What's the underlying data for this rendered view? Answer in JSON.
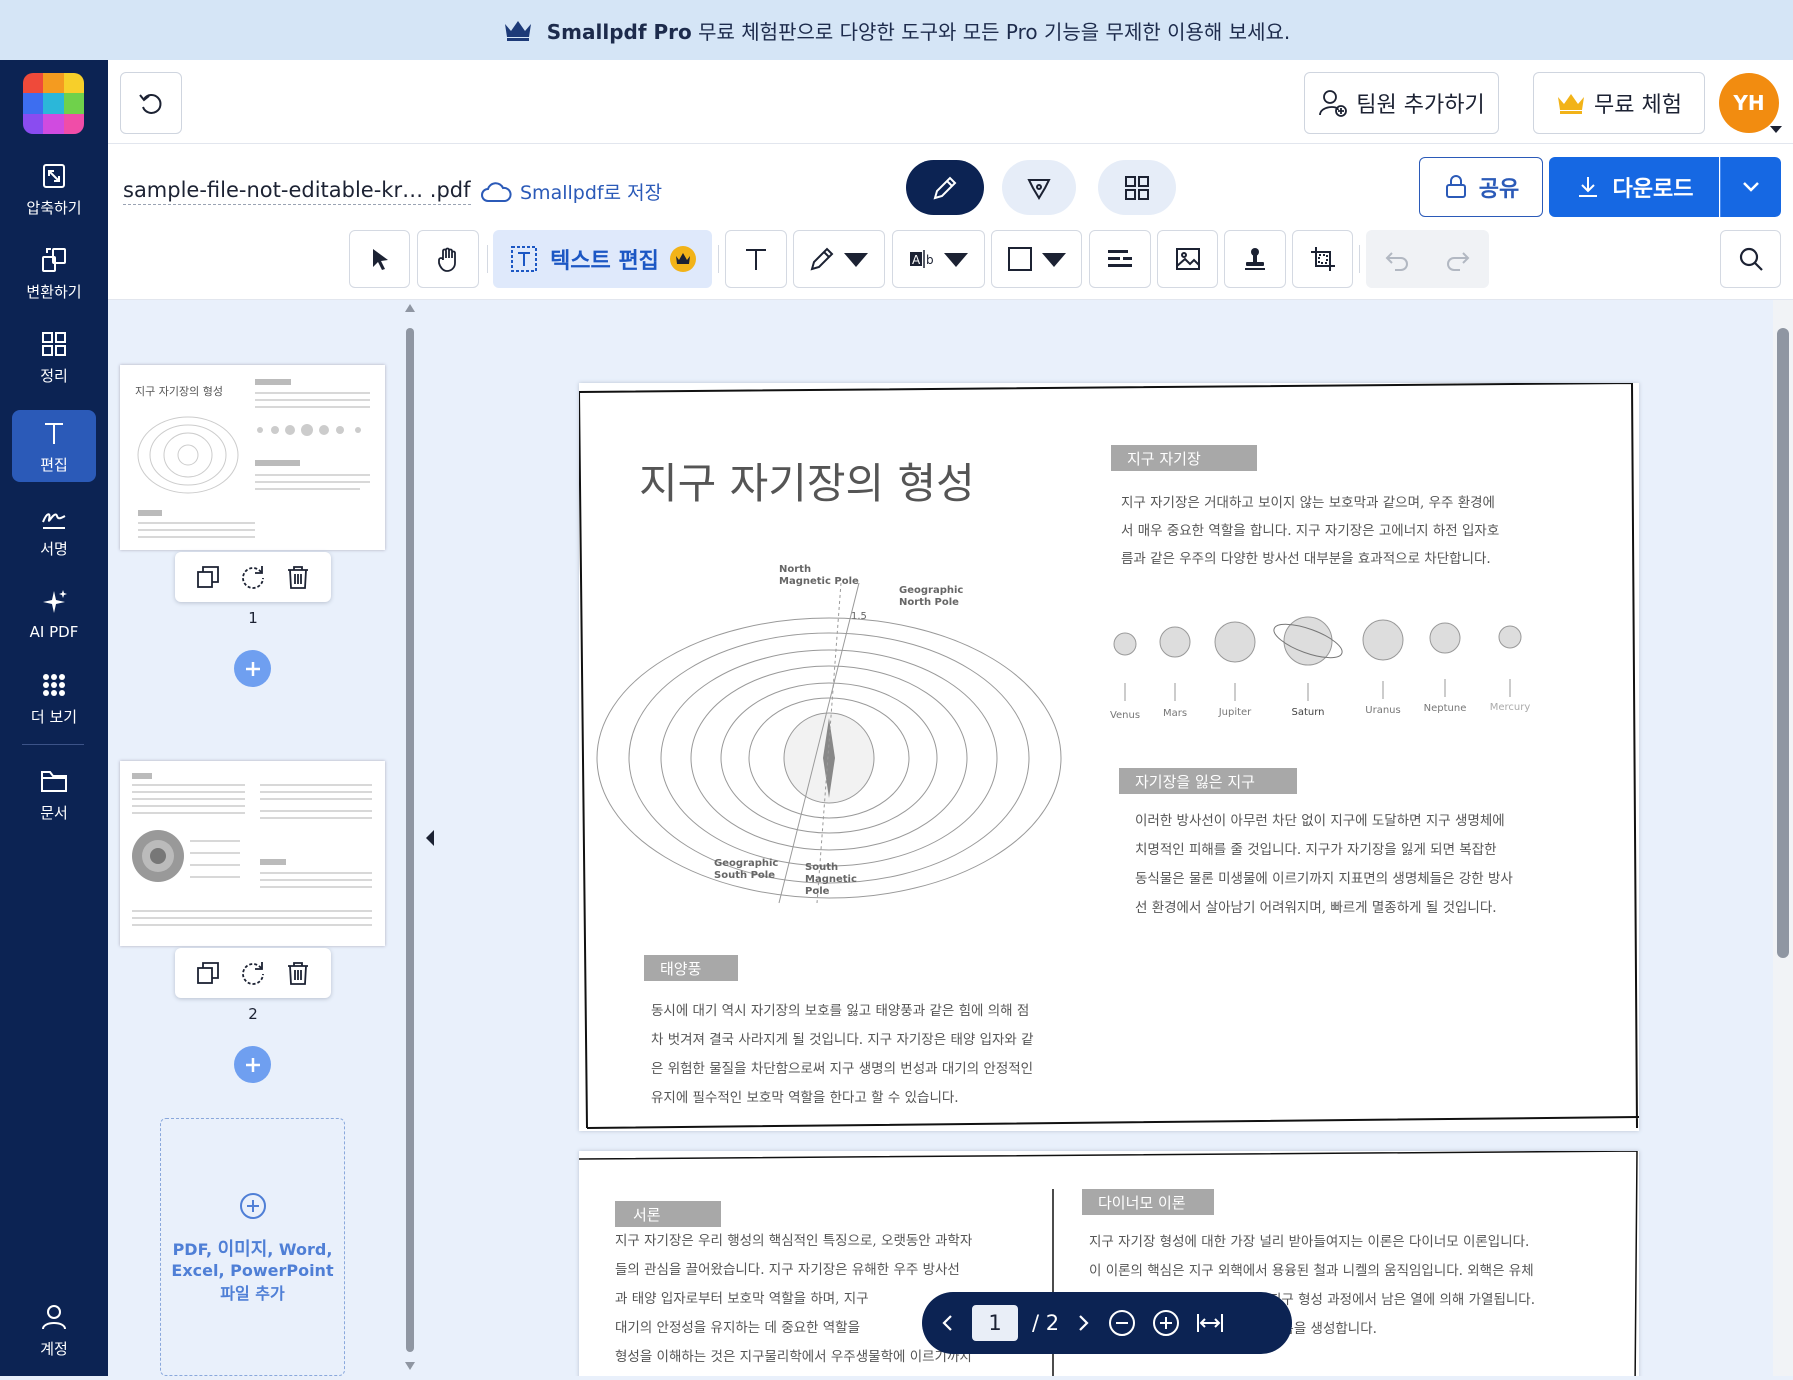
{
  "banner": {
    "brand": "Smallpdf Pro",
    "message": " 무료 체험판으로 다양한 도구와 모든 Pro 기능을 무제한 이용해 보세요."
  },
  "sidebar": {
    "items": [
      {
        "label": "압축하기",
        "icon": "compress-icon"
      },
      {
        "label": "변환하기",
        "icon": "convert-icon"
      },
      {
        "label": "정리",
        "icon": "organize-icon"
      },
      {
        "label": "편집",
        "icon": "edit-text-icon"
      },
      {
        "label": "서명",
        "icon": "signature-icon"
      },
      {
        "label": "AI PDF",
        "icon": "ai-sparkle-icon"
      },
      {
        "label": "더 보기",
        "icon": "more-grid-icon"
      },
      {
        "label": "문서",
        "icon": "folder-icon"
      },
      {
        "label": "계정",
        "icon": "account-icon"
      }
    ],
    "active": "편집"
  },
  "topbar": {
    "add_member": "팀원 추가하기",
    "free_trial": "무료 체험",
    "avatar": "YH"
  },
  "document": {
    "filename": "sample-file-not-editable-kr… .pdf",
    "save_to": "Smallpdf로 저장"
  },
  "actions": {
    "share": "공유",
    "download": "다운로드"
  },
  "toolbar": {
    "text_edit": "텍스트 편집"
  },
  "thumbnails": {
    "pages": [
      "1",
      "2"
    ],
    "dropzone": [
      "PDF, ",
      "이미지",
      ", Word, Excel, PowerPoint 파일 추가"
    ]
  },
  "pager": {
    "current": "1",
    "total": "/ 2"
  },
  "page1": {
    "title": "지구 자기장의 형성",
    "sec1_title": "지구 자기장",
    "sec1_lines": [
      "지구 자기장은 거대하고 보이지 않는 보호막과 같으며, 우주 환경에",
      "서 매우 중요한 역할을 합니다. 지구 자기장은 고에너지 하전 입자호",
      "름과 같은 우주의 다양한 방사선 대부분을 효과적으로 차단합니다."
    ],
    "planets": [
      "Venus",
      "Mars",
      "Jupiter",
      "Saturn",
      "Uranus",
      "Neptune",
      "Mercury"
    ],
    "diagram_labels": {
      "north_mag": [
        "North",
        "Magnetic Pole"
      ],
      "geo_north": [
        "Geographic",
        "North Pole"
      ],
      "geo_south": [
        "Geographic",
        "South Pole"
      ],
      "south_mag": [
        "South",
        "Magnetic",
        "Pole"
      ],
      "angle": "1.5"
    },
    "sec2_title": "자기장을 잃은 지구",
    "sec2_lines": [
      "이러한 방사선이 아무런 차단 없이 지구에 도달하면 지구 생명체에",
      "치명적인 피해를 줄 것입니다. 지구가 자기장을 잃게 되면 복잡한",
      "동식물은 물론 미생물에 이르기까지 지표면의 생명체들은 강한 방사",
      "선 환경에서 살아남기 어려워지며, 빠르게 멸종하게 될 것입니다."
    ],
    "sec3_title": "태양풍",
    "sec3_lines": [
      "동시에 대기 역시 자기장의 보호를 잃고 태양풍과 같은 힘에 의해 점",
      "차 벗겨져 결국 사라지게 될 것입니다. 지구 자기장은 태양 입자와 같",
      "은 위험한 물질을 차단함으로써 지구 생명의 번성과 대기의 안정적인",
      "유지에 필수적인 보호막 역할을 한다고 할 수 있습니다."
    ]
  },
  "page2": {
    "left_title": "서론",
    "left_lines": [
      "지구 자기장은 우리 행성의 핵심적인 특징으로, 오랫동안 과학자",
      "들의 관심을 끌어왔습니다. 지구 자기장은 유해한 우주 방사선",
      "과 태양 입자로부터 보호막 역할을 하며, 지구",
      "대기의 안정성을 유지하는 데 중요한 역할을",
      "형성을 이해하는 것은 지구물리학에서 우주생물학에 이르기까지"
    ],
    "right_title": "다이너모 이론",
    "right_lines": [
      "지구 자기장 형성에 대한 가장 널리 받아들여지는 이론은 다이너모 이론입니다.",
      "이 이론의 핵심은 지구 외핵에서 용융된 철과 니켈의 움직임입니다. 외핵은 유체",
      "지구 형성 과정에서 남은 열에 의해 가열됩니다.",
      "흐름을 생성합니다."
    ]
  }
}
